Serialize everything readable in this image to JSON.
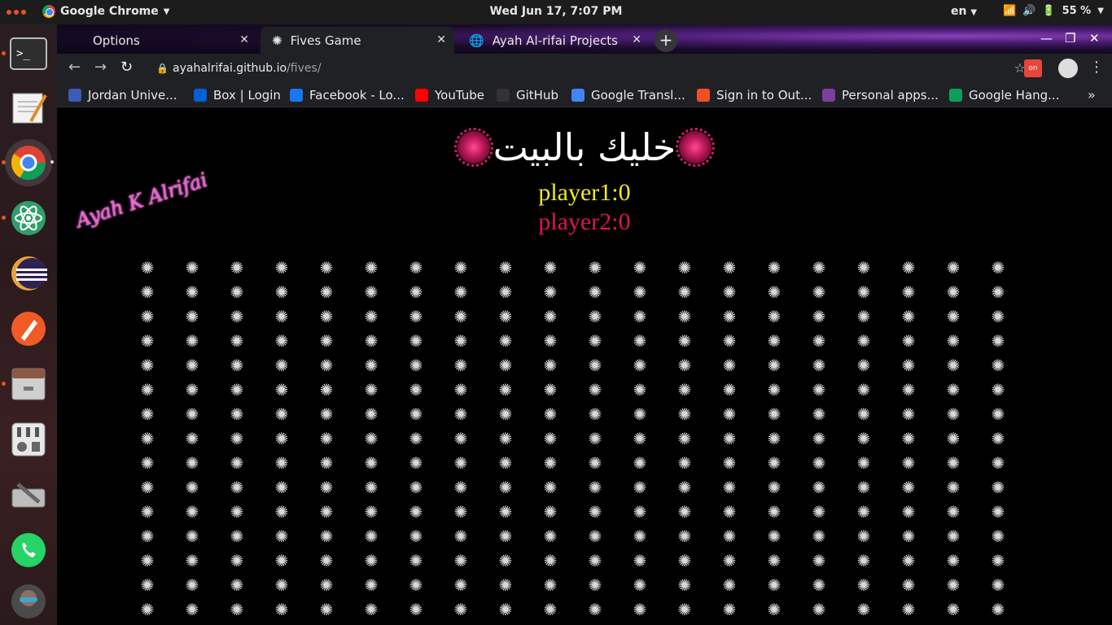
{
  "topbar": {
    "app_name": "Google Chrome",
    "app_menu_icon": "chevron-down-icon",
    "clock": "Wed Jun 17,  7:07 PM",
    "lang": "en",
    "battery": "55 %"
  },
  "dock": {
    "items": [
      {
        "name": "terminal-icon"
      },
      {
        "name": "text-editor-icon"
      },
      {
        "name": "chrome-icon"
      },
      {
        "name": "atom-icon"
      },
      {
        "name": "eclipse-icon"
      },
      {
        "name": "inkscape-icon"
      },
      {
        "name": "file-cabinet-icon"
      },
      {
        "name": "mixer-icon"
      },
      {
        "name": "disk-tools-icon"
      },
      {
        "name": "whatsapp-icon"
      },
      {
        "name": "avatar-icon"
      }
    ]
  },
  "tabs": [
    {
      "label": "Options",
      "close": "✕"
    },
    {
      "label": "Fives Game",
      "close": "✕",
      "icon": "✺"
    },
    {
      "label": "Ayah Al-rifai Projects",
      "close": "✕"
    }
  ],
  "omnibar": {
    "url_host": "ayahalrifai.github.io",
    "url_path": "/fives/"
  },
  "bookmarks": [
    {
      "label": "Jordan Unive...",
      "color": "#3b5bb5"
    },
    {
      "label": "Box | Login",
      "color": "#0061d5"
    },
    {
      "label": "Facebook - Lo...",
      "color": "#1877f2"
    },
    {
      "label": "YouTube",
      "color": "#ff0000"
    },
    {
      "label": "GitHub",
      "color": "#333333"
    },
    {
      "label": "Google Transl...",
      "color": "#4285f4"
    },
    {
      "label": "Sign in to Out...",
      "color": "#f25022"
    },
    {
      "label": "Personal apps...",
      "color": "#7b3fa0"
    },
    {
      "label": "Google Hang...",
      "color": "#0f9d58"
    }
  ],
  "game": {
    "title": "خليك بالبيت",
    "player1": "player1:0",
    "player2": "player2:0",
    "signature": "Ayah K Alrifai",
    "cell_symbol": "✺",
    "grid_cols": 20,
    "grid_rows": 15
  }
}
